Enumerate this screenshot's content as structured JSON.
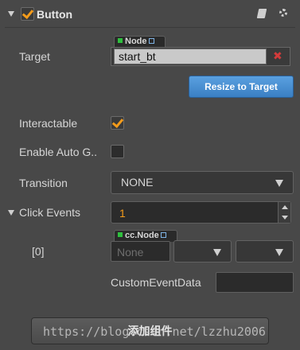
{
  "component": {
    "title": "Button"
  },
  "target": {
    "label": "Target",
    "tag": "Node",
    "value": "start_bt"
  },
  "resize_button": "Resize to Target",
  "interactable": {
    "label": "Interactable",
    "checked": true
  },
  "enable_auto_gray": {
    "label": "Enable Auto G..",
    "checked": false
  },
  "transition": {
    "label": "Transition",
    "value": "NONE"
  },
  "click_events": {
    "label": "Click Events",
    "count": "1",
    "items": [
      {
        "index": "[0]",
        "tag": "cc.Node",
        "node_placeholder": "None",
        "custom_event_data_label": "CustomEventData"
      }
    ]
  },
  "add_component_button": "添加组件",
  "watermark": "https://blog.csdn.net/lzzhu2006",
  "colors": {
    "background": "#484848",
    "accent_orange": "#f39b1b",
    "primary_blue": "#3a7fc3",
    "remove_red": "#d33b3b",
    "node_green": "#2fbf3e"
  }
}
